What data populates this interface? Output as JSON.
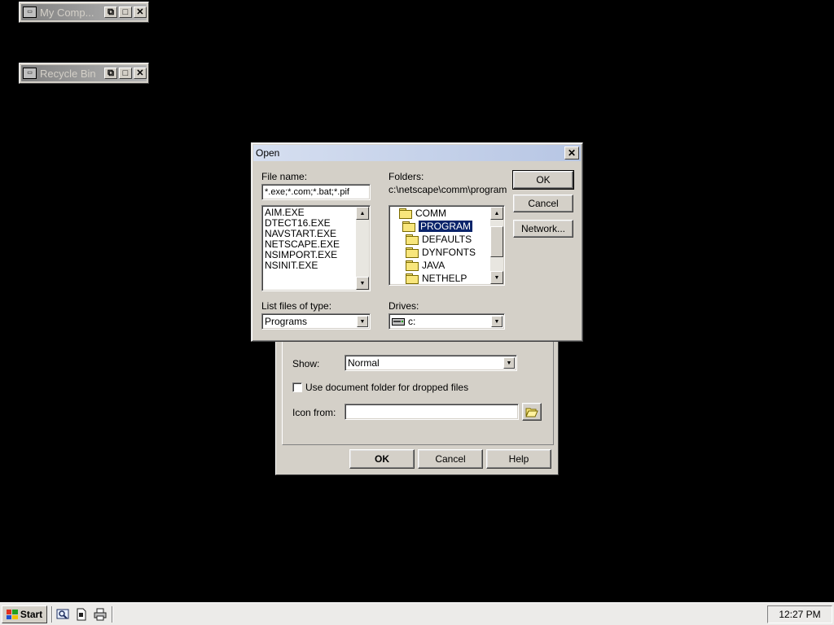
{
  "desktop": {
    "minimized_windows": [
      {
        "title": "My Comp...",
        "icon": "app-window-icon"
      },
      {
        "title": "Recycle Bin",
        "icon": "app-window-icon"
      }
    ]
  },
  "properties_dialog": {
    "show_label": "Show:",
    "show_value": "Normal",
    "checkbox_label": "Use document folder for dropped files",
    "checkbox_checked": false,
    "icon_from_label": "Icon from:",
    "icon_from_value": "",
    "buttons": {
      "ok": "OK",
      "cancel": "Cancel",
      "help": "Help"
    }
  },
  "open_dialog": {
    "title": "Open",
    "file_name_label": "File name:",
    "file_name_value": "*.exe;*.com;*.bat;*.pif",
    "files": [
      "AIM.EXE",
      "DTECT16.EXE",
      "NAVSTART.EXE",
      "NETSCAPE.EXE",
      "NSIMPORT.EXE",
      "NSINIT.EXE"
    ],
    "folders_label": "Folders:",
    "current_path": "c:\\netscape\\comm\\program",
    "folders": [
      {
        "name": "COMM",
        "state": "open"
      },
      {
        "name": "PROGRAM",
        "state": "open-selected"
      },
      {
        "name": "DEFAULTS",
        "state": "closed"
      },
      {
        "name": "DYNFONTS",
        "state": "closed"
      },
      {
        "name": "JAVA",
        "state": "closed"
      },
      {
        "name": "NETHELP",
        "state": "closed"
      }
    ],
    "list_type_label": "List files of type:",
    "list_type_value": "Programs",
    "drives_label": "Drives:",
    "drives_value": "c:",
    "buttons": {
      "ok": "OK",
      "cancel": "Cancel",
      "network": "Network..."
    }
  },
  "taskbar": {
    "start_label": "Start",
    "quick_launch": [
      "explorer-icon",
      "document-icon",
      "printer-icon"
    ],
    "clock": "12:27 PM"
  }
}
